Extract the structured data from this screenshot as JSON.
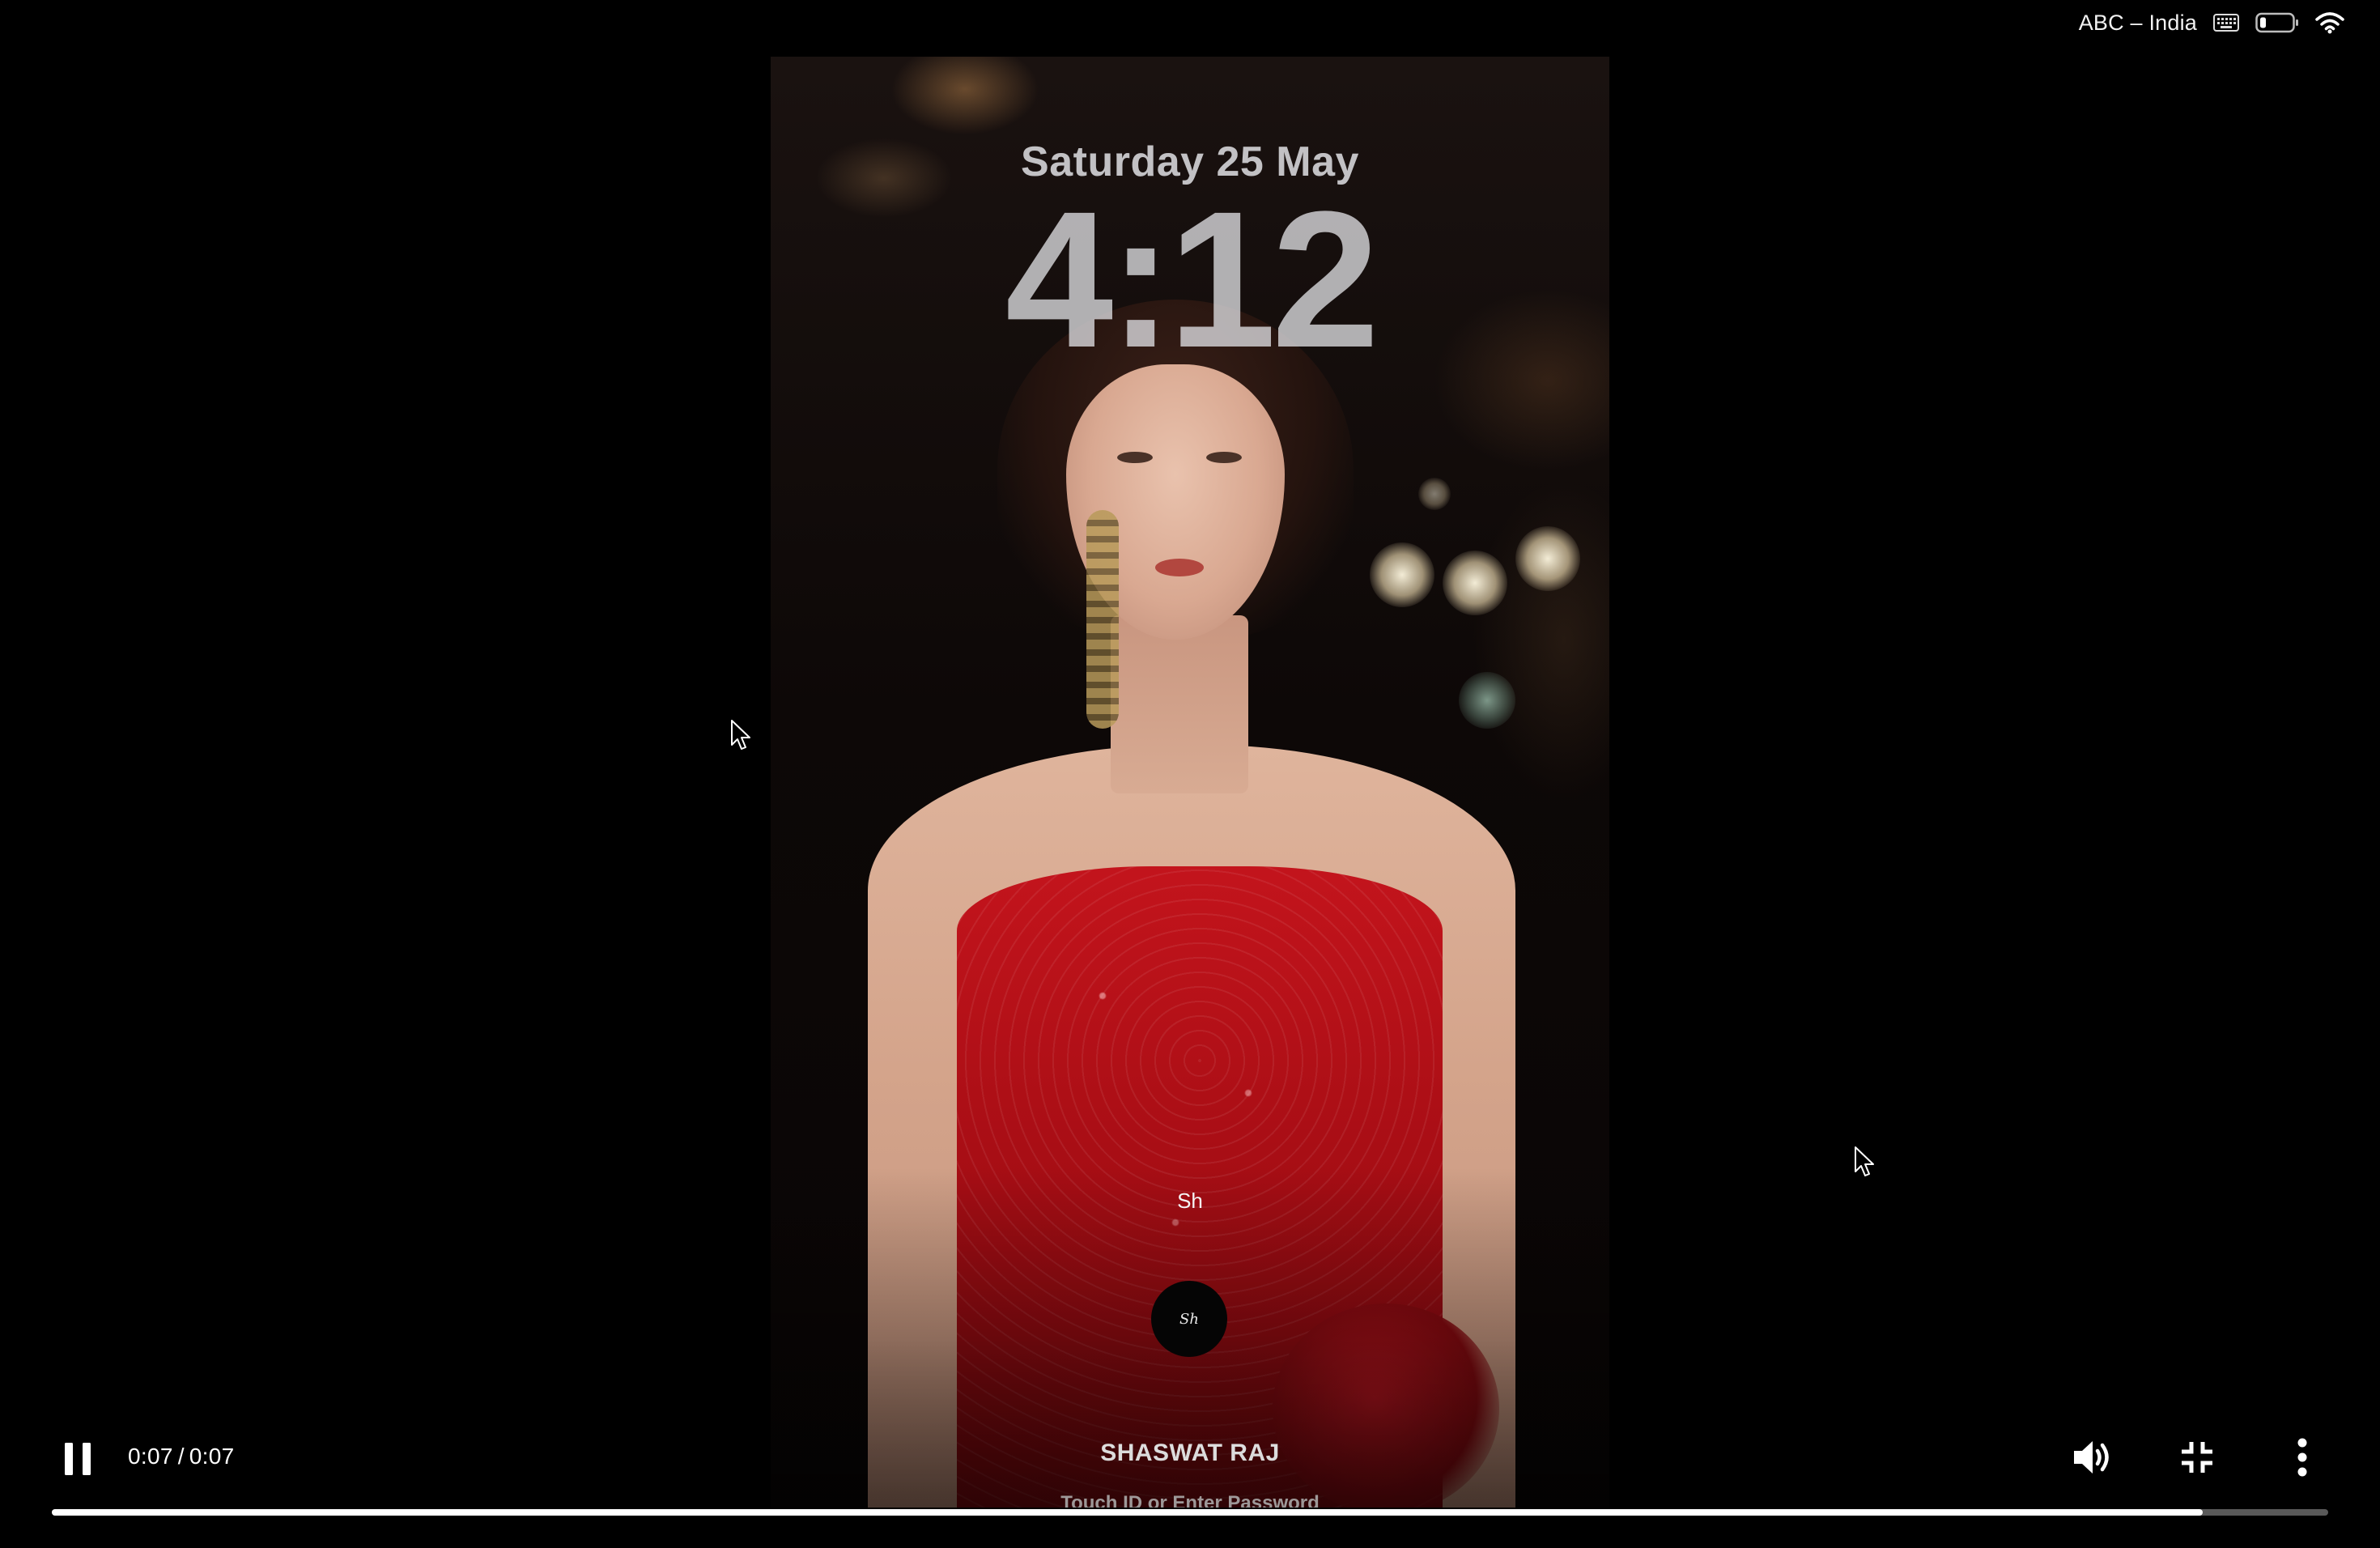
{
  "menubar": {
    "input_source": "ABC – India",
    "icons": [
      "keyboard-icon",
      "battery-icon",
      "wifi-icon"
    ]
  },
  "lock_screen": {
    "date": "Saturday 25 May",
    "time": "4:12",
    "hint_text": "Sh",
    "avatar_initials": "Sh",
    "username": "SHASWAT RAJ",
    "password_prompt": "Touch ID or Enter Password"
  },
  "player": {
    "current_time": "0:07",
    "duration": "0:07",
    "progress_fraction": 0.945,
    "state": "playing",
    "controls": [
      "pause-icon",
      "volume-icon",
      "exit-fullscreen-icon",
      "more-vert-icon"
    ]
  },
  "colors": {
    "background": "#000000",
    "dress_red": "#c3141c",
    "progress_fill": "#ffffff"
  }
}
